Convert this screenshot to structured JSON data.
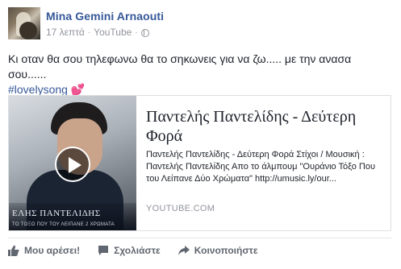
{
  "post": {
    "author": "Mina Gemini Arnaouti",
    "time": "17 λεπτά",
    "via": "YouTube",
    "text": "Κι οταν θα σου τηλεφωνω θα το σηκωνεις για να ζω..... με την ανασα σου......",
    "hashtag": "#lovelysong",
    "emoji": "💕"
  },
  "card": {
    "title": "Παντελής Παντελίδης - Δεύτερη Φορά",
    "description": "Παντελής Παντελίδης - Δεύτερη Φορά Στίχοι / Μουσική : Παντελής Παντελίδης Απο το άλμπουμ \"Ουράνιο Τόξο Που του Λείπανε Δύο Χρώματα\" http://umusic.ly/our...",
    "domain": "YOUTUBE.COM",
    "thumb_caption": "ΕΛΗΣ ΠΑΝΤΕΛΙΔΗΣ",
    "thumb_subcaption": "ΤΟ ΤΟΞΟ ΠΟΥ ΤΟΥ ΛΕΙΠΑΝΕ 2 ΧΡΩΜΑΤΑ"
  },
  "actions": {
    "like": "Μου αρέσει!",
    "comment": "Σχολιάστε",
    "share": "Κοινοποιήστε"
  },
  "colors": {
    "link": "#365899",
    "meta": "#90949c",
    "action": "#616770"
  },
  "icons": [
    "globe-icon",
    "play-icon",
    "like-icon",
    "comment-icon",
    "share-icon"
  ]
}
